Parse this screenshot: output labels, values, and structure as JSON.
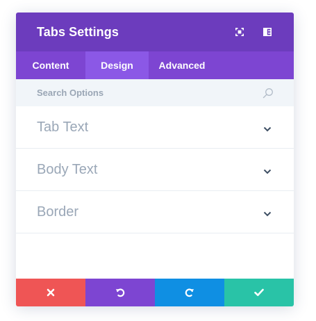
{
  "modal": {
    "title": "Tabs Settings",
    "header_icons": [
      "expand-icon",
      "sidebar-layout-icon"
    ]
  },
  "tabs": [
    {
      "label": "Content",
      "active": false
    },
    {
      "label": "Design",
      "active": true
    },
    {
      "label": "Advanced",
      "active": false
    }
  ],
  "search": {
    "placeholder": "Search Options",
    "icon": "search-icon"
  },
  "sections": [
    {
      "label": "Tab Text",
      "icon": "chevron-down-icon"
    },
    {
      "label": "Body Text",
      "icon": "chevron-down-icon"
    },
    {
      "label": "Border",
      "icon": "chevron-down-icon"
    }
  ],
  "footer": {
    "buttons": [
      {
        "name": "cancel",
        "icon": "close-icon",
        "color": "#ef5555"
      },
      {
        "name": "undo",
        "icon": "undo-icon",
        "color": "#7d45d2"
      },
      {
        "name": "redo",
        "icon": "redo-icon",
        "color": "#0f8fe3"
      },
      {
        "name": "save",
        "icon": "checkmark-icon",
        "color": "#29c3a7"
      }
    ]
  },
  "colors": {
    "header": "#6c3cbd",
    "tab_bar": "#7d45d2",
    "tab_active": "#8b58e6",
    "search_bg": "#f1f5f9",
    "section_text": "#9aa7b7"
  }
}
